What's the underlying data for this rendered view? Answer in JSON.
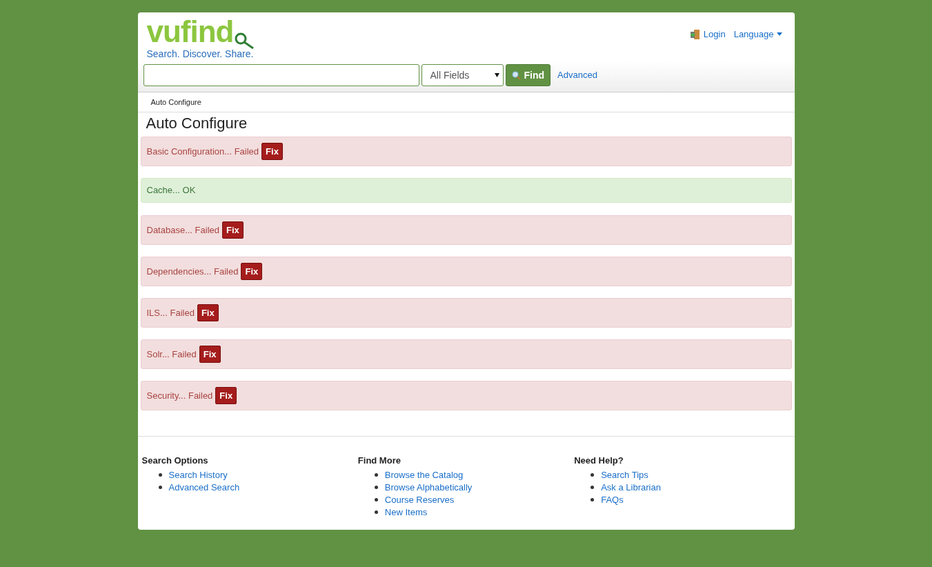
{
  "header": {
    "logo": "vufind",
    "tagline": "Search. Discover. Share.",
    "login": "Login",
    "language": "Language"
  },
  "search": {
    "type": "All Fields",
    "button": "Find",
    "advanced": "Advanced"
  },
  "breadcrumb": "Auto Configure",
  "title": "Auto Configure",
  "checks": [
    {
      "label": "Basic Configuration... Failed",
      "kind": "failed",
      "action": "Fix"
    },
    {
      "label": "Cache... OK",
      "kind": "ok"
    },
    {
      "label": "Database... Failed",
      "kind": "failed",
      "action": "Fix"
    },
    {
      "label": "Dependencies... Failed",
      "kind": "failed",
      "action": "Fix"
    },
    {
      "label": "ILS... Failed",
      "kind": "failed",
      "action": "Fix"
    },
    {
      "label": "Solr... Failed",
      "kind": "failed",
      "action": "Fix"
    },
    {
      "label": "Security... Failed",
      "kind": "failed",
      "action": "Fix"
    }
  ],
  "footer": [
    {
      "heading": "Search Options",
      "links": [
        "Search History",
        "Advanced Search"
      ]
    },
    {
      "heading": "Find More",
      "links": [
        "Browse the Catalog",
        "Browse Alphabetically",
        "Course Reserves",
        "New Items"
      ]
    },
    {
      "heading": "Need Help?",
      "links": [
        "Search Tips",
        "Ask a Librarian",
        "FAQs"
      ]
    }
  ]
}
